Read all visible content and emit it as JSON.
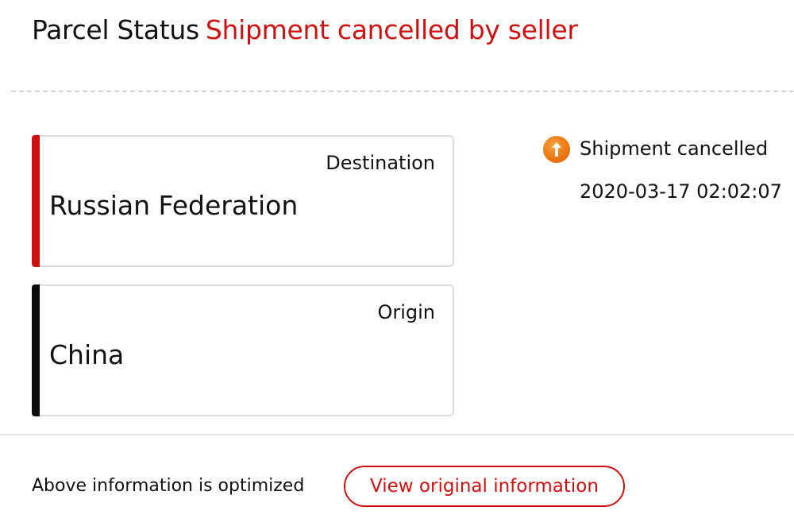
{
  "header": {
    "label": "Parcel Status",
    "status": "Shipment cancelled by seller",
    "status_color": "#cc1111"
  },
  "destination": {
    "title": "Destination",
    "value": "Russian Federation",
    "accent_color": "#cc1111"
  },
  "origin": {
    "title": "Origin",
    "value": "China",
    "accent_color": "#0d0d0d"
  },
  "event": {
    "icon": "arrow-up-circle-icon",
    "icon_color": "#ec7410",
    "label": "Shipment cancelled",
    "time": "2020-03-17 02:02:07"
  },
  "footer": {
    "note": "Above information is optimized",
    "button_label": "View original information"
  }
}
